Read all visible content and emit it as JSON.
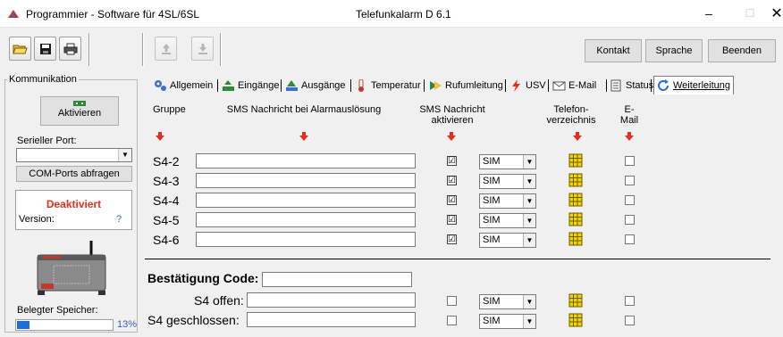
{
  "window": {
    "title": "Programmier - Software für 4SL/6SL",
    "subtitle": "Telefunkalarm  D 6.1",
    "minimize": "–",
    "maximize": "☐",
    "close": "✕"
  },
  "toolbar": {
    "kontakt": "Kontakt",
    "sprache": "Sprache",
    "beenden": "Beenden"
  },
  "left": {
    "group_title": "Kommunikation",
    "activate_button": "Aktivieren",
    "serial_port_label": "Serieller Port:",
    "serial_port_value": "",
    "com_button": "COM-Ports abfragen",
    "status": "Deaktiviert",
    "version_label": "Version:",
    "version_value": "?",
    "memory_label": "Belegter Speicher:",
    "memory_percent": "13%",
    "memory_fraction": 0.13
  },
  "tabs": [
    {
      "label": "Allgemein"
    },
    {
      "label": "Eingänge"
    },
    {
      "label": "Ausgänge"
    },
    {
      "label": "Temperatur"
    },
    {
      "label": "Rufumleitung"
    },
    {
      "label": "USV"
    },
    {
      "label": "E-Mail"
    },
    {
      "label": "Status"
    },
    {
      "label": "Weiterleitung"
    }
  ],
  "headers": {
    "gruppe": "Gruppe",
    "sms_text": "SMS Nachricht bei Alarmauslösung",
    "sms_activate_1": "SMS Nachricht",
    "sms_activate_2": "aktivieren",
    "phone_1": "Telefon-",
    "phone_2": "verzeichnis",
    "email": "E-Mail"
  },
  "rows": [
    {
      "label": "S4-2",
      "message": "",
      "sms_checked": "☑",
      "mode": "SIM"
    },
    {
      "label": "S4-3",
      "message": "",
      "sms_checked": "☑",
      "mode": "SIM"
    },
    {
      "label": "S4-4",
      "message": "",
      "sms_checked": "☑",
      "mode": "SIM"
    },
    {
      "label": "S4-5",
      "message": "",
      "sms_checked": "☑",
      "mode": "SIM"
    },
    {
      "label": "S4-6",
      "message": "",
      "sms_checked": "☑",
      "mode": "SIM"
    }
  ],
  "confirm": {
    "label": "Bestätigung Code:",
    "value": "",
    "rows": [
      {
        "label": "S4 offen:",
        "message": "",
        "mode": "SIM"
      },
      {
        "label": "S4 geschlossen:",
        "message": "",
        "mode": "SIM"
      }
    ]
  }
}
